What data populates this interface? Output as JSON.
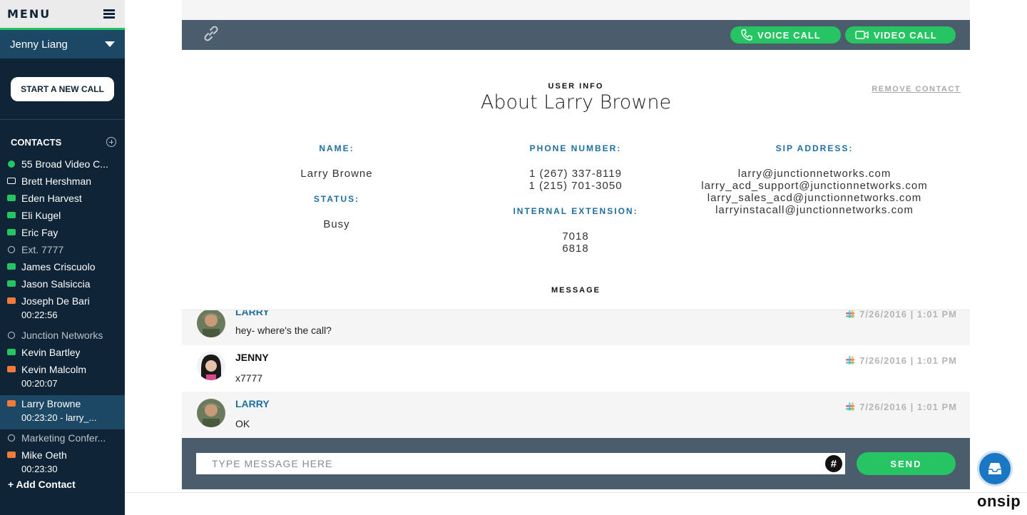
{
  "sidebar": {
    "menu_title": "MENU",
    "user_name": "Jenny Liang",
    "start_call_label": "START A NEW CALL",
    "contacts_title": "CONTACTS",
    "add_contact_label": "+ Add Contact",
    "contacts": [
      {
        "name": "55 Broad Video C...",
        "sub": "",
        "status": "dot-green"
      },
      {
        "name": "Brett Hershman",
        "sub": "",
        "status": "chat-white"
      },
      {
        "name": "Eden Harvest",
        "sub": "",
        "status": "chat-green"
      },
      {
        "name": "Eli Kugel",
        "sub": "",
        "status": "chat-green"
      },
      {
        "name": "Eric Fay",
        "sub": "",
        "status": "chat-green"
      },
      {
        "name": "Ext. 7777",
        "sub": "",
        "status": "ring"
      },
      {
        "name": "James Criscuolo",
        "sub": "",
        "status": "chat-green"
      },
      {
        "name": "Jason Salsiccia",
        "sub": "",
        "status": "chat-green"
      },
      {
        "name": "Joseph De Bari",
        "sub": "00:22:56",
        "status": "chat-orange"
      },
      {
        "name": "Junction Networks",
        "sub": "",
        "status": "ring"
      },
      {
        "name": "Kevin Bartley",
        "sub": "",
        "status": "chat-green"
      },
      {
        "name": "Kevin Malcolm",
        "sub": "00:20:07",
        "status": "chat-orange"
      },
      {
        "name": "Larry Browne",
        "sub": "00:23:20 - larry_...",
        "status": "chat-orange"
      },
      {
        "name": "Marketing Confer...",
        "sub": "",
        "status": "ring"
      },
      {
        "name": "Mike Oeth",
        "sub": "00:23:30",
        "status": "chat-orange"
      }
    ]
  },
  "call_bar": {
    "voice_label": "VOICE CALL",
    "video_label": "VIDEO CALL"
  },
  "user_info": {
    "section_label": "USER INFO",
    "title": "About Larry Browne",
    "remove_label": "REMOVE CONTACT",
    "name_label": "NAME:",
    "name_value": "Larry Browne",
    "status_label": "STATUS:",
    "status_value": "Busy",
    "phone_label": "PHONE NUMBER:",
    "phones": [
      "1 (267) 337-8119",
      "1 (215) 701-3050"
    ],
    "ext_label": "INTERNAL EXTENSION:",
    "extensions": [
      "7018",
      "6818"
    ],
    "sip_label": "SIP ADDRESS:",
    "sips": [
      "larry@junctionnetworks.com",
      "larry_acd_support@junctionnetworks.com",
      "larry_sales_acd@junctionnetworks.com",
      "larryinstacall@junctionnetworks.com"
    ],
    "message_label": "MESSAGE"
  },
  "messages": [
    {
      "from": "LARRY",
      "text": "hey- where's the call?",
      "time": "7/26/2016 | 1:01 PM"
    },
    {
      "from": "JENNY",
      "text": "x7777",
      "time": "7/26/2016 | 1:01 PM"
    },
    {
      "from": "LARRY",
      "text": "OK",
      "time": "7/26/2016 | 1:01 PM"
    }
  ],
  "compose": {
    "placeholder": "TYPE MESSAGE HERE",
    "hash_label": "#",
    "send_label": "SEND"
  },
  "brand": "onsip",
  "colors": {
    "sidebar_bg": "#0f2436",
    "sidebar_active": "#1d4865",
    "accent_green": "#26c463",
    "status_orange": "#f07a3a",
    "bar_grey": "#4b5d6c",
    "link_blue": "#1f6ea0"
  }
}
